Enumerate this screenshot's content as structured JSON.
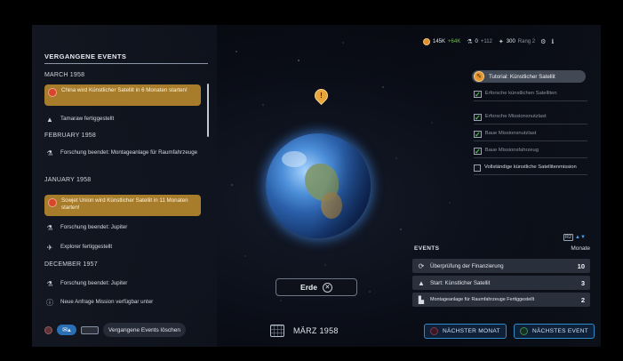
{
  "events_panel": {
    "title": "VERGANGENE EVENTS",
    "months": {
      "march": "MARCH 1958",
      "february": "FEBRUARY 1958",
      "january": "JANUARY 1958",
      "december": "DECEMBER 1957"
    },
    "items": {
      "china_alert": "China wird Künstlicher Satellit in 6 Monaten starten!",
      "tamaraw": "Tamaraw fertiggestellt",
      "research_assembly": "Forschung beendet: Montageanlage für Raumfahrzeuge",
      "soviet_alert": "Sowjet Union wird Künstlicher Satellit in 11 Monaten starten!",
      "research_jupiter_1": "Forschung beendet: Jupiter",
      "explorer": "Explorer fertiggestellt",
      "research_jupiter_2": "Forschung beendet: Jupiter",
      "new_request": "Neue Anfrage Mission verfügbar unter"
    },
    "clear_label": "Vergangene Events löschen"
  },
  "globe": {
    "label": "Erde"
  },
  "date": {
    "current": "MÄRZ 1958"
  },
  "resources": {
    "money": "145K",
    "money_delta": "+64K",
    "science": "0",
    "science_delta": "+112",
    "reputation": "300",
    "rank": "Rang 2"
  },
  "tutorial": {
    "title": "Tutorial: Künstlicher Satellit",
    "tasks": [
      {
        "label": "Erforsche künstlichen Satelliten",
        "done": true
      },
      {
        "label": "Erforsche Missionsnutzlast",
        "done": true
      },
      {
        "label": "Baue Missionsnutzlast",
        "done": true
      },
      {
        "label": "Baue Missionsfahrzeug",
        "done": true
      },
      {
        "label": "Vollständige künstliche Satellitenmission",
        "done": false
      }
    ]
  },
  "events": {
    "title": "EVENTS",
    "unit": "Monate",
    "button_key": "R2",
    "rows": [
      {
        "label": "Überprüfung der Finanzierung",
        "value": "10"
      },
      {
        "label": "Start: Künstlicher Satellit",
        "value": "3"
      },
      {
        "label": "Montageanlage für Raumfahrzeuge Fertiggestellt",
        "value": "2"
      }
    ]
  },
  "buttons": {
    "next_month": "NÄCHSTER MONAT",
    "next_event": "NÄCHSTES EVENT"
  },
  "colors": {
    "alert_bg": "#a77d2b",
    "check_green": "#4fc24e",
    "button_border": "#2e8bc8",
    "globe_glow": "#4696ff"
  }
}
